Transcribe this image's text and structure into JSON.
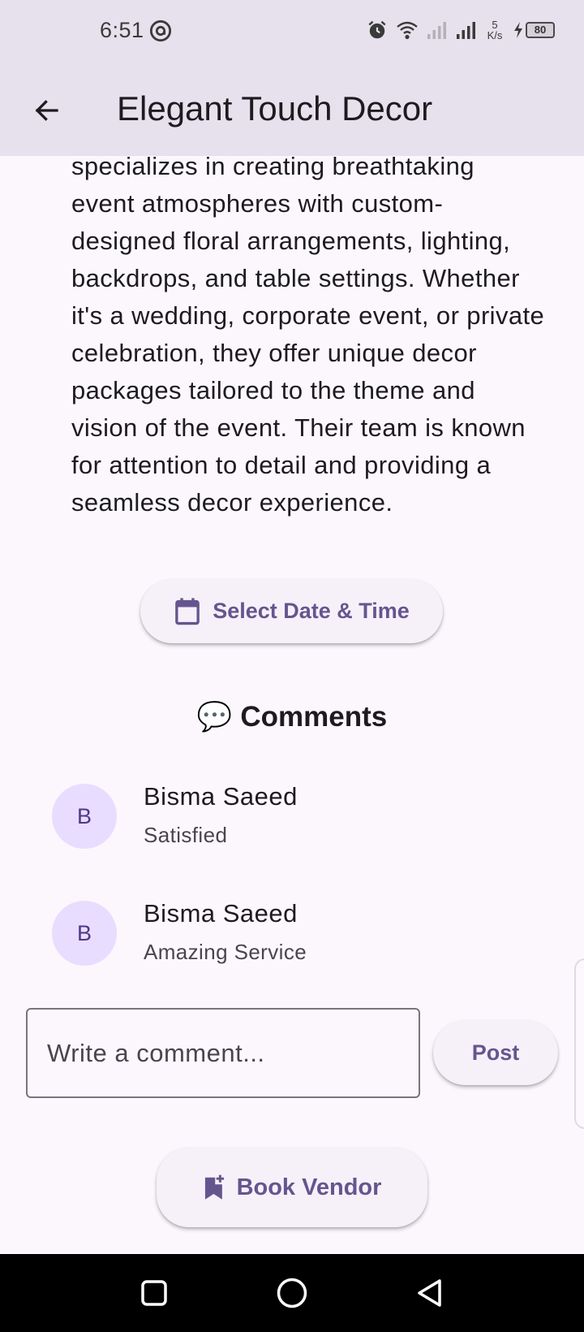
{
  "status_bar": {
    "time": "6:51",
    "net_speed_value": "5",
    "net_speed_unit": "K/s",
    "battery": "80"
  },
  "app_bar": {
    "title": "Elegant Touch Decor"
  },
  "description": {
    "lines": [
      "specializes in creating breathtaking",
      "event atmospheres with custom-",
      "designed floral arrangements, lighting,",
      "backdrops, and table settings. Whether",
      "it's a wedding, corporate event, or private",
      "celebration, they offer unique decor",
      "packages tailored to the theme and",
      "vision of the event. Their team is known",
      "for attention to detail and providing a",
      "seamless decor experience."
    ]
  },
  "date_button": {
    "label": "Select Date & Time"
  },
  "comments": {
    "title": "Comments",
    "emoji": "💬",
    "items": [
      {
        "initial": "B",
        "name": "Bisma Saeed",
        "text": "Satisfied"
      },
      {
        "initial": "B",
        "name": "Bisma Saeed",
        "text": "Amazing Service"
      }
    ],
    "input_placeholder": "Write a comment...",
    "post_label": "Post"
  },
  "book_button": {
    "label": "Book Vendor"
  },
  "colors": {
    "accent": "#65558f",
    "app_bar_bg": "#e6e1ec",
    "page_bg": "#fcf7fd",
    "avatar_bg": "#e8ddff"
  }
}
